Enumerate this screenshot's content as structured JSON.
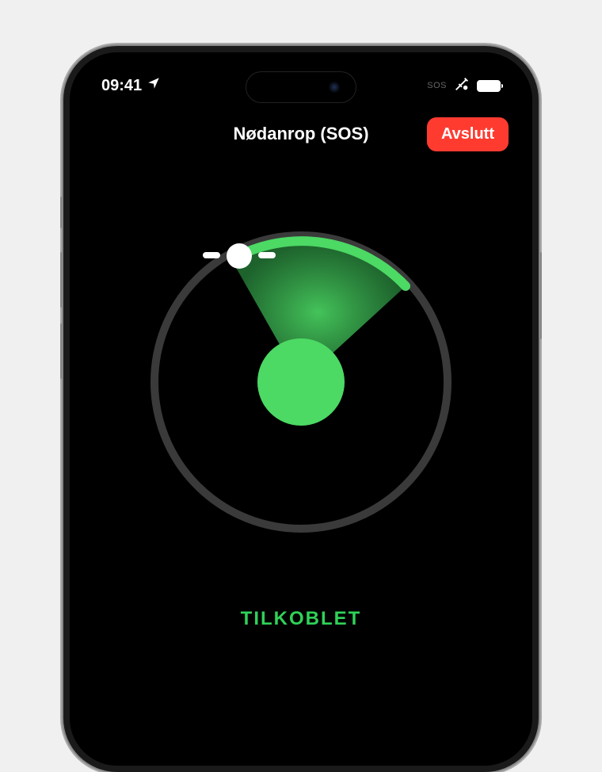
{
  "statusBar": {
    "time": "09:41",
    "sosLabel": "SOS"
  },
  "header": {
    "title": "Nødanrop (SOS)",
    "endButton": "Avslutt"
  },
  "status": {
    "connectedLabel": "TILKOBLET"
  },
  "colors": {
    "accent": "#30d158",
    "radarGreen": "#4cd964",
    "danger": "#ff3b30",
    "ring": "#3a3a3a"
  }
}
